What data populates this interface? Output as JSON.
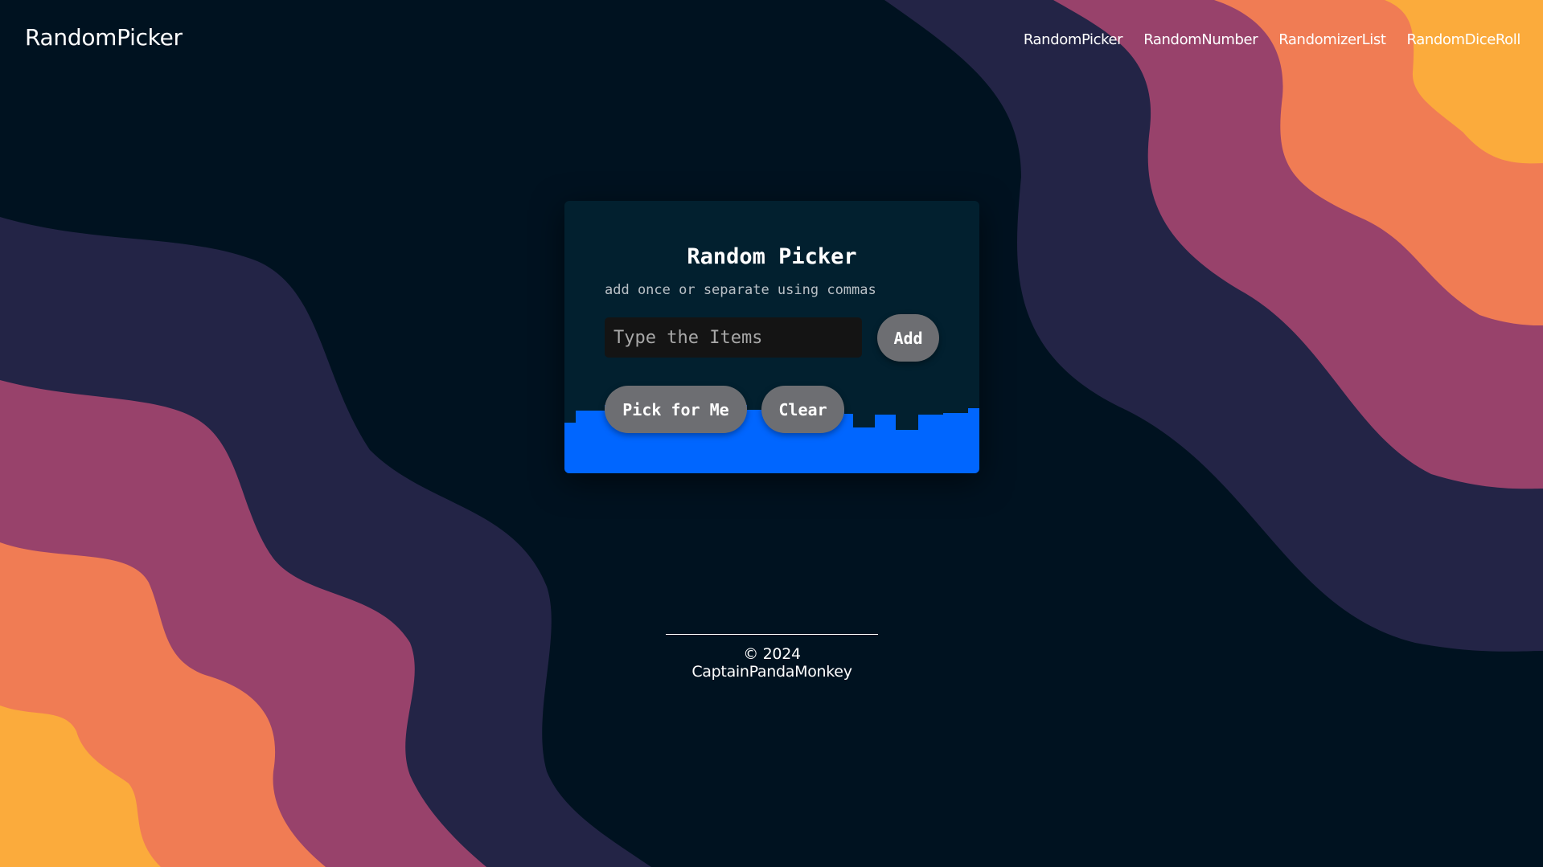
{
  "header": {
    "brand": "RandomPicker",
    "nav": [
      "RandomPicker",
      "RandomNumber",
      "RandomizerList",
      "RandomDiceRoll"
    ]
  },
  "card": {
    "title": "Random Picker",
    "subtitle": "add once or separate using commas",
    "input_placeholder": "Type the Items",
    "input_value": "",
    "add_label": "Add",
    "pick_label": "Pick for Me",
    "clear_label": "Clear"
  },
  "footer": {
    "copyright": "© 2024 CaptainPandaMonkey"
  },
  "colors": {
    "background": "#001220",
    "wave_navy": "#232446",
    "wave_plum": "#98426b",
    "wave_coral": "#f07c54",
    "wave_amber": "#fbab3c",
    "card_background": "#02202f",
    "card_fill": "#0066ff",
    "button_background": "#6d6e72"
  }
}
